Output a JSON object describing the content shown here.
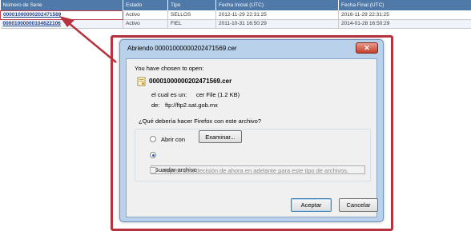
{
  "table": {
    "headers": [
      "Número de Serie",
      "Estado",
      "Tipo",
      "Fecha Inicial (UTC)",
      "Fecha Final (UTC)"
    ],
    "rows": [
      [
        "00001000000202471569",
        "Activo",
        "SELLOS",
        "2012-11-29 22:31:25",
        "2016-11-29 22:31:25"
      ],
      [
        "00001000000104622106",
        "Activo",
        "FIEL",
        "2011-10-31 16:50:29",
        "2014-01-28 16:50:29"
      ]
    ]
  },
  "dialog": {
    "title": "Abriendo 00001000000202471569.cer",
    "close_symbol": "✕",
    "intro": "You have chosen to open:",
    "filename": "00001000000202471569.cer",
    "type_label": "el cual es un:",
    "type_value": "cer File (1.2 KB)",
    "from_label": "de:",
    "from_value": "ftp://ftp2.sat.gob.mx",
    "question": "¿Qué debería hacer Firefox con este archivo?",
    "open_with_label": "Abrir con",
    "browse_label": "Examinar...",
    "save_label": "Guardar archivo",
    "remember_label": "Repetir esta decisión de ahora en adelante para este tipo de archivos.",
    "accept_label": "Aceptar",
    "cancel_label": "Cancelar"
  },
  "colors": {
    "table_header": "#4f79a8",
    "highlight": "#b5323e",
    "dialog_frame": "#b9d1ea"
  }
}
